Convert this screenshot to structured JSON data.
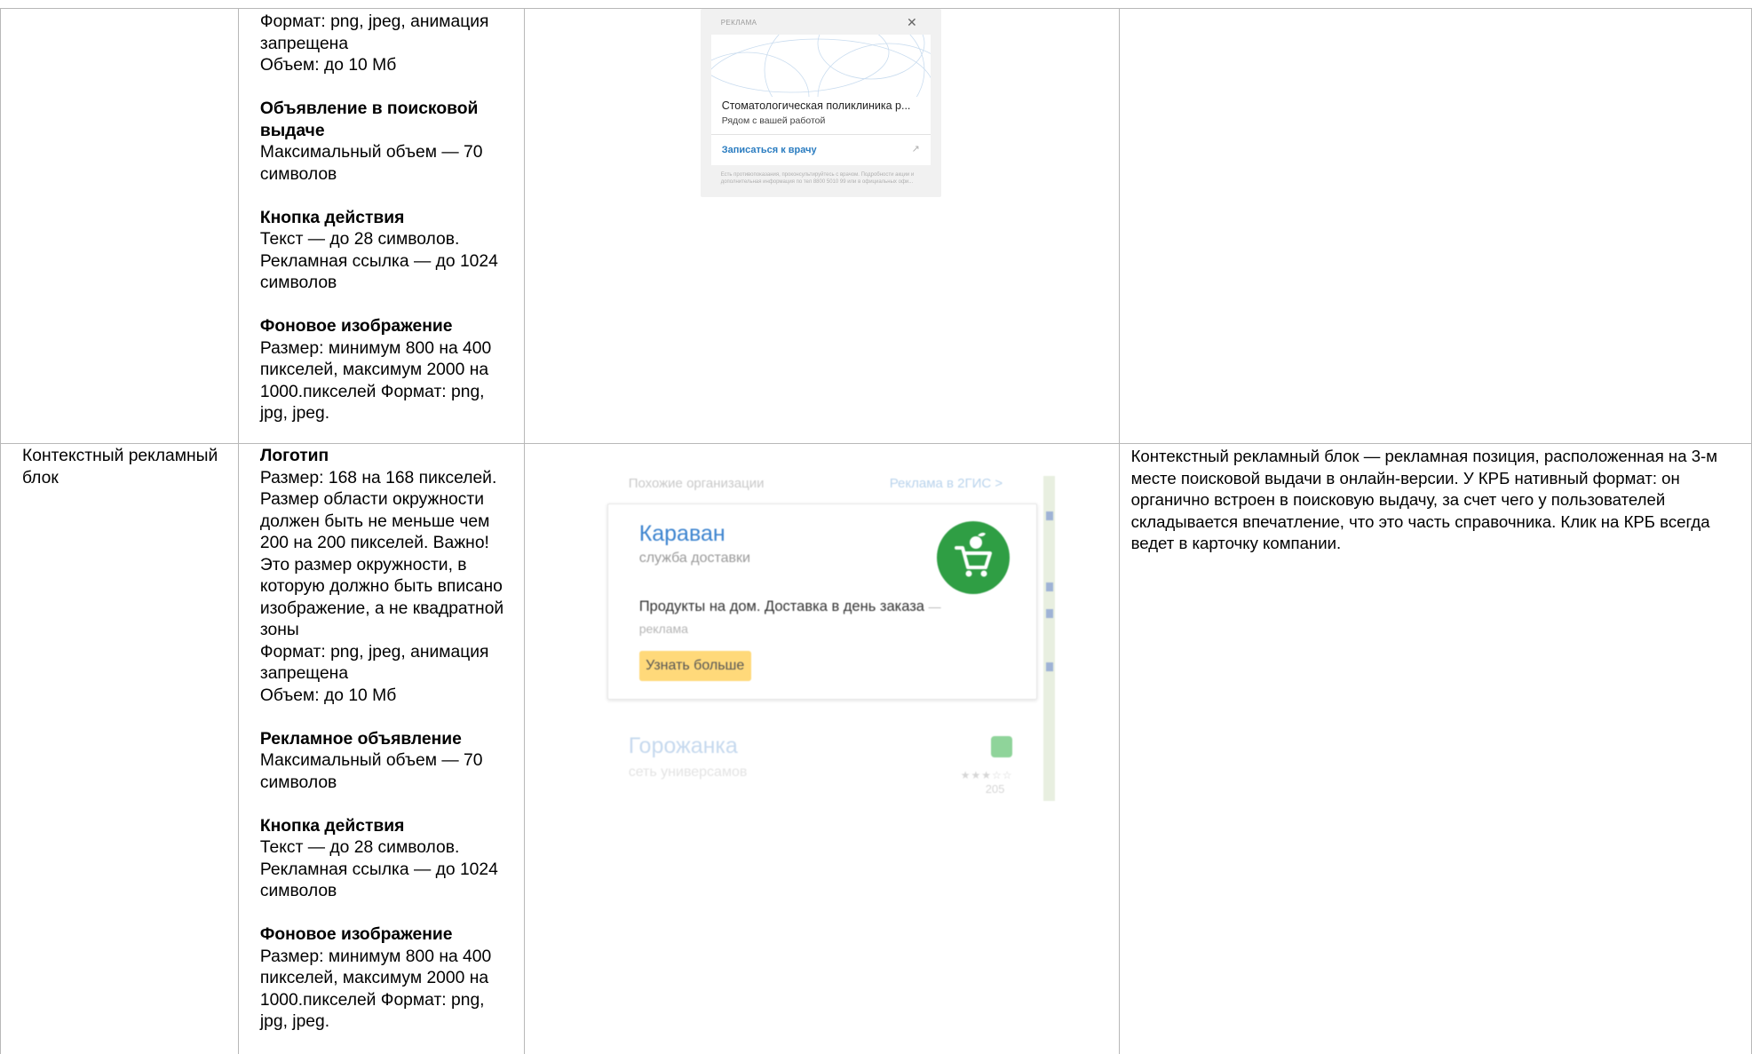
{
  "rows": [
    {
      "type_label": "",
      "specs": [
        {
          "heading": "",
          "lines": [
            "Формат: png, jpeg, анимация запрещена",
            "Объем: до 10 Мб"
          ]
        },
        {
          "heading": "Объявление в поисковой выдаче",
          "lines": [
            "Максимальный объем — 70 символов"
          ]
        },
        {
          "heading": "Кнопка действия",
          "lines": [
            "Текст — до 28 символов. Рекламная ссылка — до 1024 символов"
          ]
        },
        {
          "heading": "Фоновое изображение",
          "lines": [
            "Размер: минимум 800 на 400 пикселей, максимум 2000 на 1000.пикселей Формат: png, jpg, jpeg."
          ]
        }
      ],
      "preview": {
        "label": "РЕКЛАМА",
        "close_icon": "close-icon",
        "title": "Стоматологическая поликлиника р...",
        "subtitle": "Рядом с вашей работой",
        "cta": "Записаться к врачу",
        "external_icon": "external-link-icon",
        "footer": "Есть противопоказания, проконсультируйтесь с врачом. Подробности акции и дополнительная информация по тел 8800 5010 99 или в официальных офи..."
      },
      "description": ""
    },
    {
      "type_label": "Контекстный рекламный блок",
      "specs": [
        {
          "heading": "Логотип",
          "lines": [
            "Размер: 168 на 168 пикселей. Размер области окружности должен быть не меньше чем 200 на 200 пикселей. Важно! Это размер окружности, в которую должно быть вписано изображение, а не квадратной зоны",
            "Формат: png, jpeg, анимация запрещена",
            "Объем: до 10 Мб"
          ]
        },
        {
          "heading": "Рекламное объявление",
          "lines": [
            "Максимальный объем — 70 символов"
          ]
        },
        {
          "heading": "Кнопка действия",
          "lines": [
            "Текст — до 28 символов. Рекламная ссылка — до 1024 символов"
          ]
        },
        {
          "heading": "Фоновое изображение",
          "lines": [
            "Размер: минимум 800 на 400 пикселей, максимум 2000 на 1000.пикселей Формат: png, jpg, jpeg."
          ]
        }
      ],
      "preview": {
        "header_left": "Похожие организации",
        "header_right": "Реклама в 2ГИС >",
        "name": "Караван",
        "kind": "служба доставки",
        "logo_icon": "cart-icon",
        "desc": "Продукты на дом. Доставка в день заказа",
        "desc_tag": "— реклама",
        "button": "Узнать больше",
        "next_name": "Горожанка",
        "next_kind": "сеть универсамов",
        "next_icon": "cart-icon",
        "next_stars": "★★★☆☆",
        "next_count": "205"
      },
      "description": "Контекстный рекламный блок — рекламная позиция, расположенная на 3-м месте поисковой выдачи в онлайн-версии. У КРБ нативный формат: он органично встроен в поисковую выдачу, за счет чего у пользователей складывается впечатление, что это часть справочника. Клик на КРБ всегда ведет в карточку компании."
    }
  ]
}
